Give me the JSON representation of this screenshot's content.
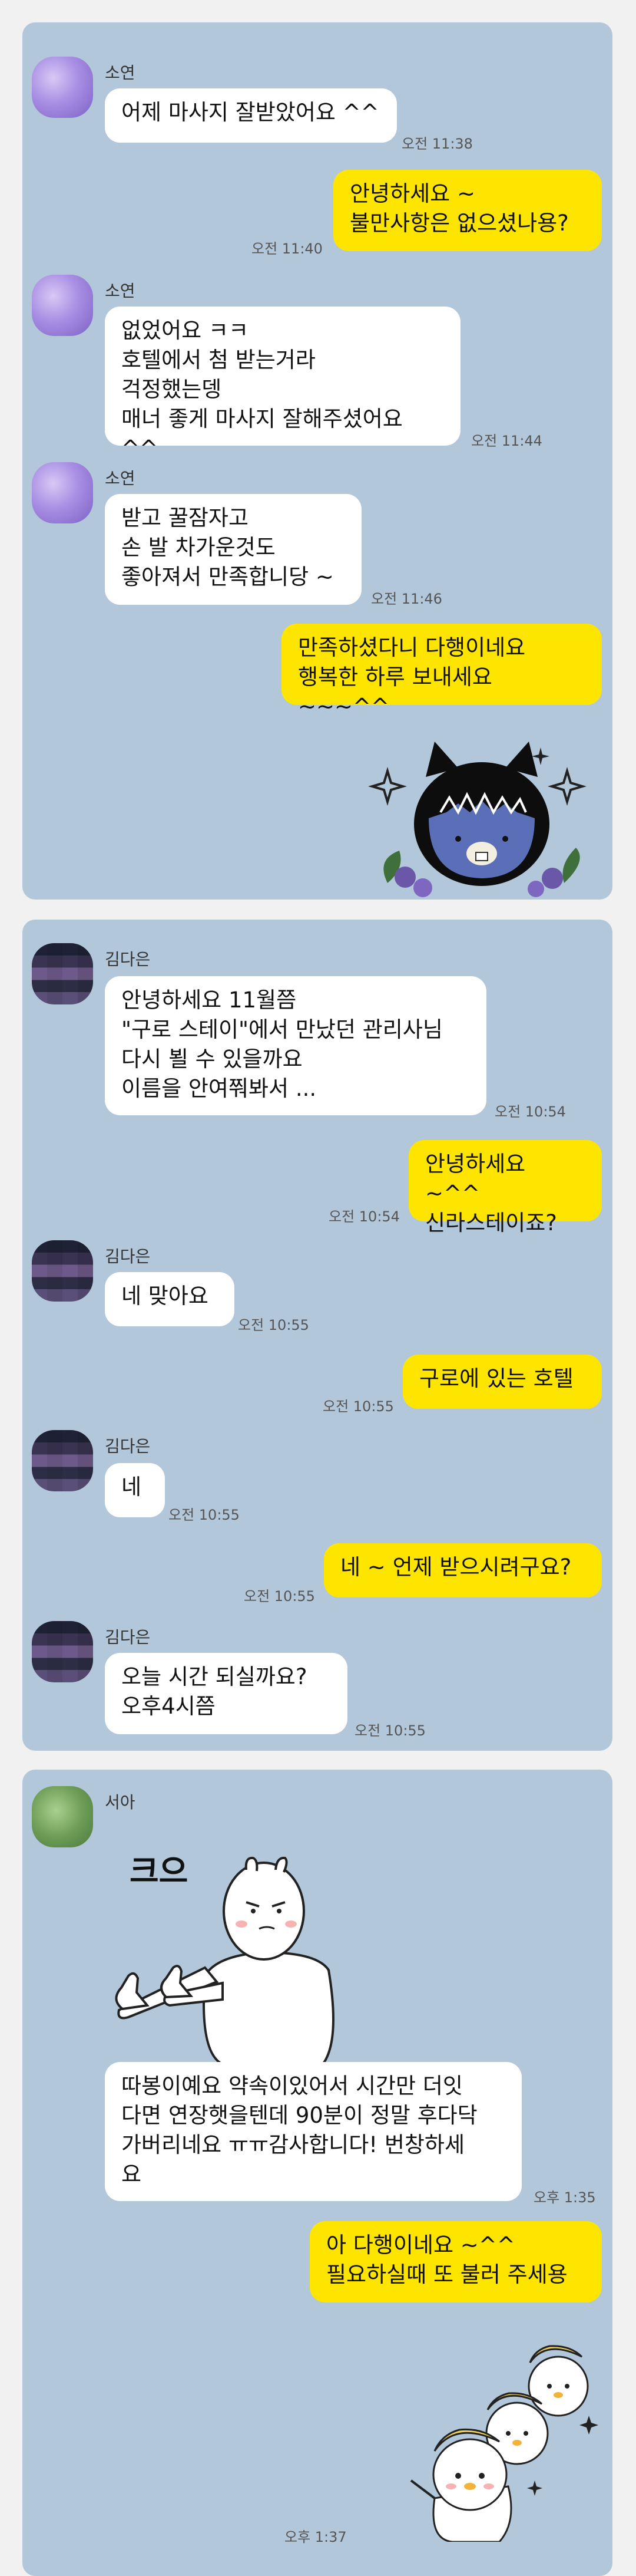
{
  "panels": [
    {
      "messages": [
        {
          "sender": "소연",
          "text": "어제 마사지 잘받았어요 ^^",
          "time": "오전 11:38"
        },
        {
          "sender": "me",
          "text": "안녕하세요 ~\n불만사항은 없으셨나용?",
          "time": "오전 11:40"
        },
        {
          "sender": "소연",
          "text": "없었어요 ㅋㅋ\n호텔에서 첨 받는거라\n걱정했는뎅\n매너 좋게 마사지 잘해주셨어요 ^^",
          "time": "오전 11:44"
        },
        {
          "sender": "소연",
          "text": "받고 꿀잠자고\n손 발 차가운것도\n좋아져서 만족합니당 ~",
          "time": "오전 11:46"
        },
        {
          "sender": "me",
          "text": "만족하셨다니 다행이네요\n행복한 하루 보내세요 ~~~^^",
          "time": ""
        }
      ],
      "sticker": "cat-sticker"
    },
    {
      "messages": [
        {
          "sender": "김다은",
          "text": "안녕하세요 11월쯤\n\"구로 스테이\"에서 만났던 관리사님\n다시 뵐 수 있을까요\n이름을 안여쭤봐서 ...",
          "time": "오전 10:54"
        },
        {
          "sender": "me",
          "text": "안녕하세요 ~^^\n신라스테이죠?",
          "time": "오전 10:54"
        },
        {
          "sender": "김다은",
          "text": "네 맞아요",
          "time": "오전 10:55"
        },
        {
          "sender": "me",
          "text": "구로에 있는 호텔",
          "time": "오전 10:55"
        },
        {
          "sender": "김다은",
          "text": "네",
          "time": "오전 10:55"
        },
        {
          "sender": "me",
          "text": "네 ~ 언제 받으시려구요?",
          "time": "오전 10:55"
        },
        {
          "sender": "김다은",
          "text": "오늘  시간 되실까요?\n오후4시쯤",
          "time": "오전 10:55"
        }
      ]
    },
    {
      "messages": [
        {
          "sender": "서아",
          "sticker_text": "크으",
          "text": "따봉이예요 약속이있어서 시간만 더잇\n다면 연장햇을텐데 90분이 정말 후다닥\n가버리네요 ㅠㅠ감사합니다! 번창하세\n요",
          "time": "오후 1:35"
        },
        {
          "sender": "me",
          "text": "아 다행이네요 ~^^\n필요하실때 또 불러 주세용",
          "time": "오후 1:37"
        }
      ]
    }
  ]
}
